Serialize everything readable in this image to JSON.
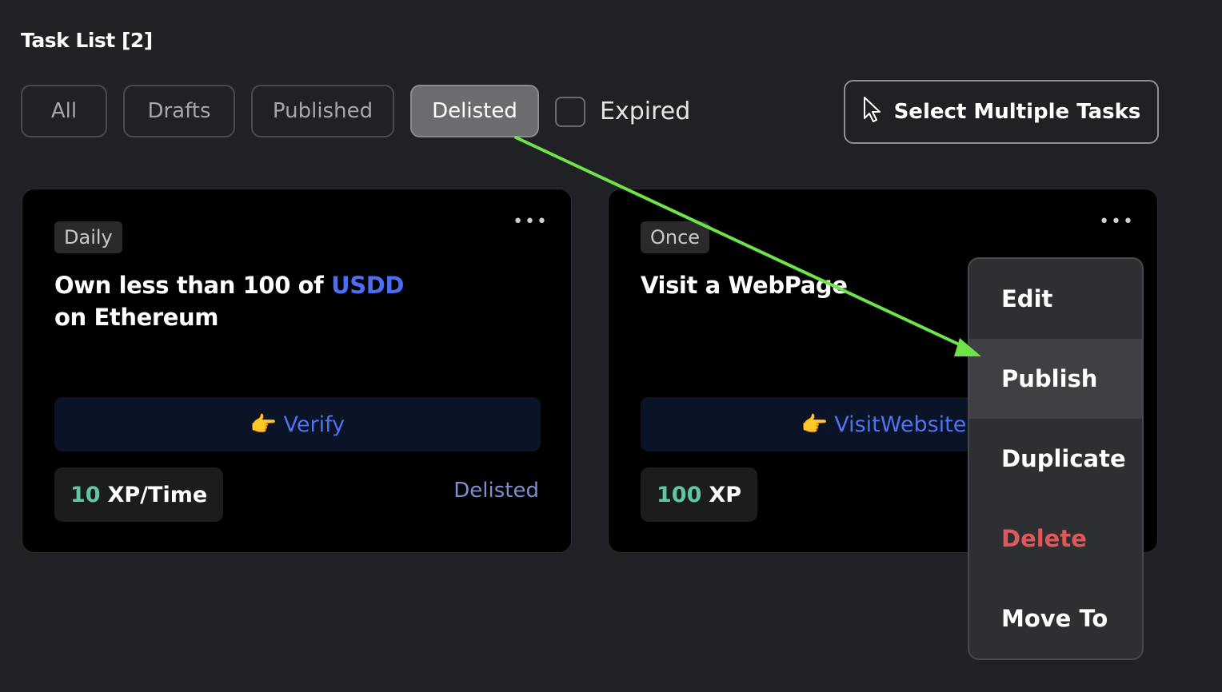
{
  "header": {
    "title": "Task List [2]"
  },
  "tabs": [
    {
      "label": "All"
    },
    {
      "label": "Drafts"
    },
    {
      "label": "Published"
    },
    {
      "label": "Delisted",
      "active": true
    }
  ],
  "filter": {
    "expired_label": "Expired",
    "expired_checked": false
  },
  "select_multiple": {
    "label": "Select Multiple Tasks",
    "icon": "cursor-arrow-icon"
  },
  "cards": [
    {
      "frequency": "Daily",
      "title_prefix": "Own less than 100 of ",
      "title_token": "USDD",
      "title_suffix": " on Ethereum",
      "action_emoji": "👉",
      "action_label": "Verify",
      "xp_value": "10",
      "xp_unit": "XP/Time",
      "status": "Delisted"
    },
    {
      "frequency": "Once",
      "title": "Visit a WebPage",
      "action_emoji": "👉",
      "action_label": "VisitWebsite",
      "xp_value": "100",
      "xp_unit": "XP"
    }
  ],
  "context_menu": {
    "items": [
      "Edit",
      "Publish",
      "Duplicate",
      "Delete",
      "Move To"
    ],
    "hovered": "Publish",
    "danger": "Delete"
  },
  "colors": {
    "background": "#202125",
    "card": "#000000",
    "accent_blue": "#4d72f5",
    "xp_green": "#5fc7a8",
    "danger_red": "#e0595a",
    "annotation_arrow": "#6ee34a"
  }
}
